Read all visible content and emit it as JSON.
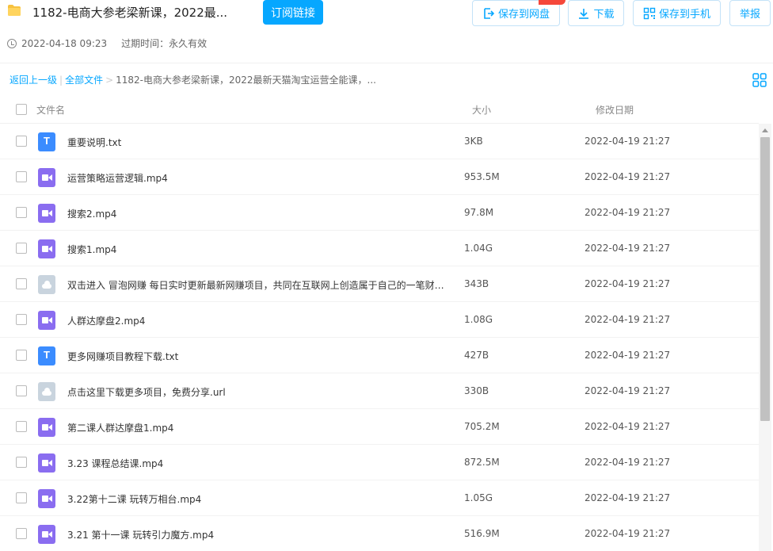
{
  "header": {
    "title": "1182-电商大参老梁新课，2022最...",
    "subscribe_label": "订阅链接",
    "save_label": "保存到网盘",
    "download_label": "下载",
    "save_phone_label": "保存到手机",
    "report_label": "举报",
    "date": "2022-04-18 09:23",
    "expire": "过期时间：永久有效"
  },
  "breadcrumb": {
    "back": "返回上一级",
    "all": "全部文件",
    "current": "1182-电商大参老梁新课，2022最新天猫淘宝运营全能课，..."
  },
  "columns": {
    "name": "文件名",
    "size": "大小",
    "date": "修改日期"
  },
  "files": [
    {
      "icon": "txt-file-icon",
      "name": "重要说明.txt",
      "size": "3KB",
      "date": "2022-04-19 21:27"
    },
    {
      "icon": "video-file-icon",
      "name": "运营策略运营逻辑.mp4",
      "size": "953.5M",
      "date": "2022-04-19 21:27"
    },
    {
      "icon": "video-file-icon",
      "name": "搜索2.mp4",
      "size": "97.8M",
      "date": "2022-04-19 21:27"
    },
    {
      "icon": "video-file-icon",
      "name": "搜索1.mp4",
      "size": "1.04G",
      "date": "2022-04-19 21:27"
    },
    {
      "icon": "url-file-icon",
      "name": "双击进入 冒泡网赚 每日实时更新最新网赚项目，共同在互联网上创造属于自己的一笔财富 .url",
      "size": "343B",
      "date": "2022-04-19 21:27"
    },
    {
      "icon": "video-file-icon",
      "name": "人群达摩盘2.mp4",
      "size": "1.08G",
      "date": "2022-04-19 21:27"
    },
    {
      "icon": "txt-file-icon",
      "name": "更多网赚项目教程下载.txt",
      "size": "427B",
      "date": "2022-04-19 21:27"
    },
    {
      "icon": "url-file-icon",
      "name": "点击这里下载更多项目，免费分享.url",
      "size": "330B",
      "date": "2022-04-19 21:27"
    },
    {
      "icon": "video-file-icon",
      "name": "第二课人群达摩盘1.mp4",
      "size": "705.2M",
      "date": "2022-04-19 21:27"
    },
    {
      "icon": "video-file-icon",
      "name": "3.23 课程总结课.mp4",
      "size": "872.5M",
      "date": "2022-04-19 21:27"
    },
    {
      "icon": "video-file-icon",
      "name": "3.22第十二课 玩转万相台.mp4",
      "size": "1.05G",
      "date": "2022-04-19 21:27"
    },
    {
      "icon": "video-file-icon",
      "name": "3.21 第十一课 玩转引力魔方.mp4",
      "size": "516.9M",
      "date": "2022-04-19 21:27"
    }
  ],
  "colors": {
    "accent": "#06a7ff",
    "badge": "#f5483b",
    "txt_icon": "#3b8cff",
    "video_icon": "#8a6df0",
    "url_icon": "#c9d4de"
  }
}
